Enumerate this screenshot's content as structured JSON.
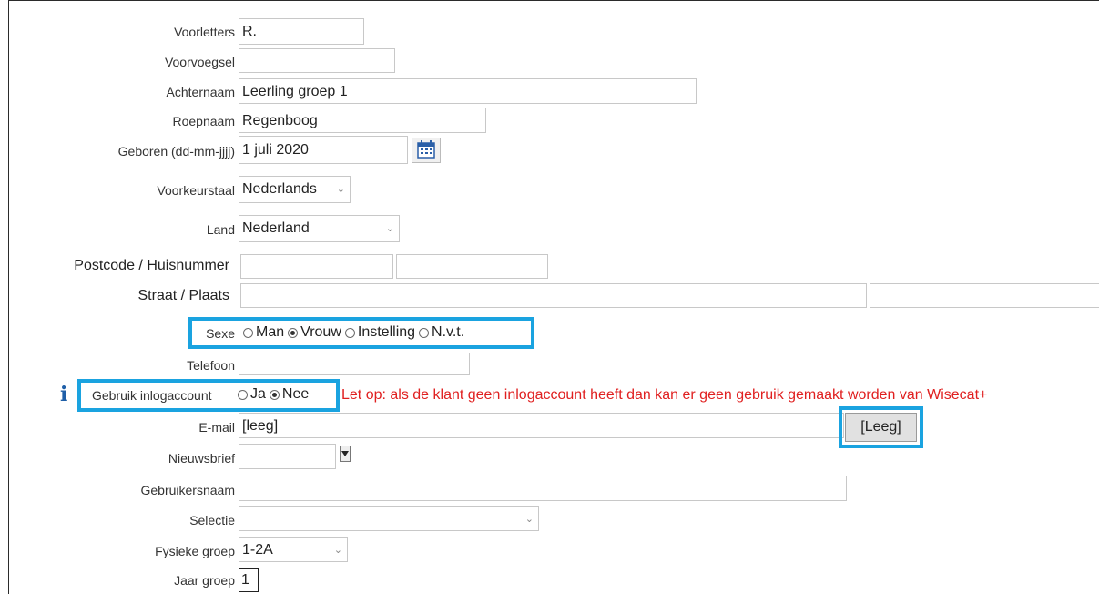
{
  "fields": {
    "voorletters": {
      "label": "Voorletters",
      "value": "R."
    },
    "voorvoegsel": {
      "label": "Voorvoegsel",
      "value": ""
    },
    "achternaam": {
      "label": "Achternaam",
      "value": "Leerling groep 1"
    },
    "roepnaam": {
      "label": "Roepnaam",
      "value": "Regenboog"
    },
    "geboren": {
      "label": "Geboren (dd-mm-jjjj)",
      "value": "1 juli 2020"
    },
    "voorkeurstaal": {
      "label": "Voorkeurstaal",
      "value": "Nederlands"
    },
    "land": {
      "label": "Land",
      "value": "Nederland"
    },
    "postcode_huisnummer": {
      "label": "Postcode / Huisnummer",
      "postcode": "",
      "huisnummer": ""
    },
    "straat_plaats": {
      "label": "Straat / Plaats",
      "straat": "",
      "plaats": ""
    },
    "sexe": {
      "label": "Sexe",
      "options": [
        "Man",
        "Vrouw",
        "Instelling",
        "N.v.t."
      ],
      "selected": "Vrouw"
    },
    "telefoon": {
      "label": "Telefoon",
      "value": ""
    },
    "gebruik_inlogaccount": {
      "label": "Gebruik inlogaccount",
      "options": [
        "Ja",
        "Nee"
      ],
      "selected": "Nee",
      "warning": "Let op: als de klant geen inlogaccount heeft dan kan er geen gebruik gemaakt worden van Wisecat+"
    },
    "email": {
      "label": "E-mail",
      "value": "[leeg]",
      "button": "[Leeg]"
    },
    "nieuwsbrief": {
      "label": "Nieuwsbrief",
      "value": ""
    },
    "gebruikersnaam": {
      "label": "Gebruikersnaam",
      "value": ""
    },
    "selectie": {
      "label": "Selectie",
      "value": ""
    },
    "fysieke_groep": {
      "label": "Fysieke groep",
      "value": "1-2A"
    },
    "jaar_groep": {
      "label": "Jaar groep",
      "value": "1"
    }
  },
  "colors": {
    "highlight": "#1aa3e0",
    "warning": "#e02020",
    "info_icon": "#1f5fa8"
  },
  "icons": {
    "calendar": "calendar-icon",
    "info": "info-icon",
    "dropdown": "chevron-down-icon"
  }
}
